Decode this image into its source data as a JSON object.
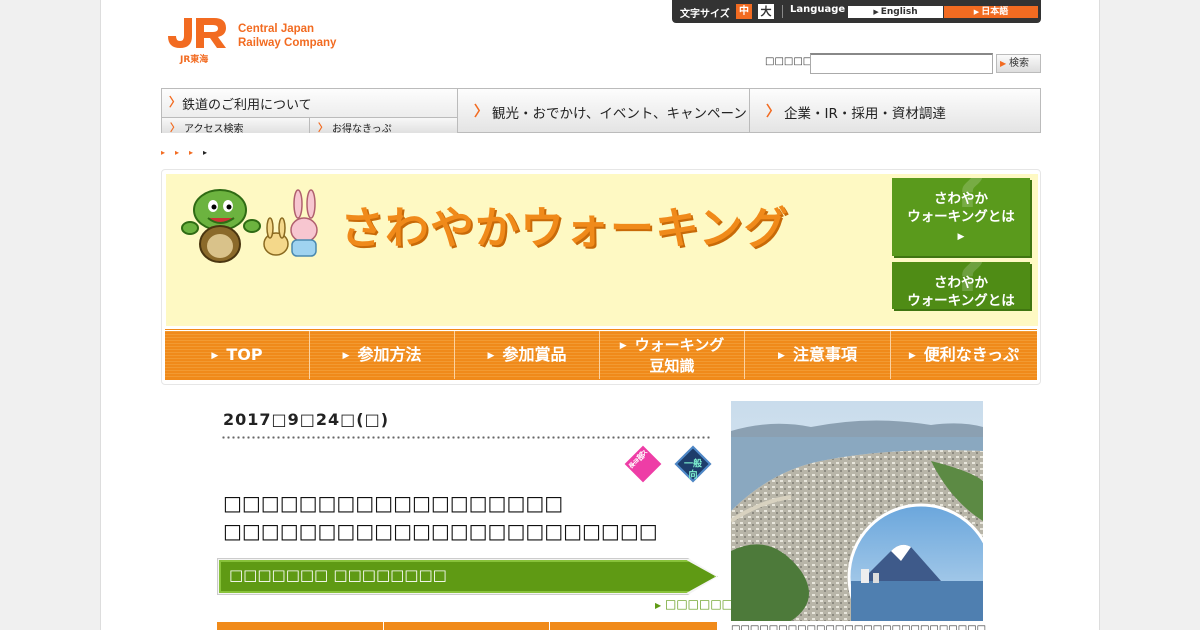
{
  "header": {
    "logo": {
      "mark": "JR",
      "sub": "JR東海",
      "company_line1": "Central Japan",
      "company_line2": "Railway Company"
    },
    "font_size": {
      "label": "文字サイズ",
      "medium": "中",
      "large": "大"
    },
    "language": {
      "label": "Language",
      "english": "English",
      "japanese": "日本語"
    },
    "search": {
      "label": "□□□□□□",
      "value": "",
      "button": "検索"
    }
  },
  "gnav": {
    "col1": {
      "main": "鉄道のご利用について",
      "sub1": "アクセス検索",
      "sub2": "お得なきっぷ"
    },
    "col2": {
      "main": "観光・おでかけ、イベント、キャンペーン"
    },
    "col3": {
      "main": "企業・IR・採用・資材調達"
    }
  },
  "hero": {
    "title": "さわやかウォーキング",
    "what_btn_1": {
      "line1": "さわやか",
      "line2": "ウォーキングとは"
    },
    "what_btn_2": {
      "line1": "さわやか",
      "line2": "ウォーキングとは"
    },
    "tabs": [
      {
        "label": "TOP"
      },
      {
        "label": "参加方法"
      },
      {
        "label": "参加賞品"
      },
      {
        "line1": "ウォーキング",
        "line2": "豆知識"
      },
      {
        "label": "注意事項"
      },
      {
        "label": "便利なきっぷ"
      }
    ]
  },
  "event": {
    "date": "2017□9□24□(□)",
    "badge1": {
      "line1": "一部",
      "line2": "長コース"
    },
    "badge2": {
      "label": "一般向"
    },
    "course_line1": "□□□□□□□□□□□□□□□□□□",
    "course_line2": "□□□□□□□□□□□□□□□□□□□□□□□",
    "station_bar": "□□□□□□□ □□□□□□□□",
    "more_link": "□□□□□□□",
    "photo_caption": "□□□□□□□□□□□□□□□□□□□□□□□□□□□"
  },
  "colors": {
    "brand_orange": "#f26b21",
    "tab_orange": "#f08a1a",
    "green": "#5f9a14",
    "hero_bg": "#fef9c3"
  }
}
